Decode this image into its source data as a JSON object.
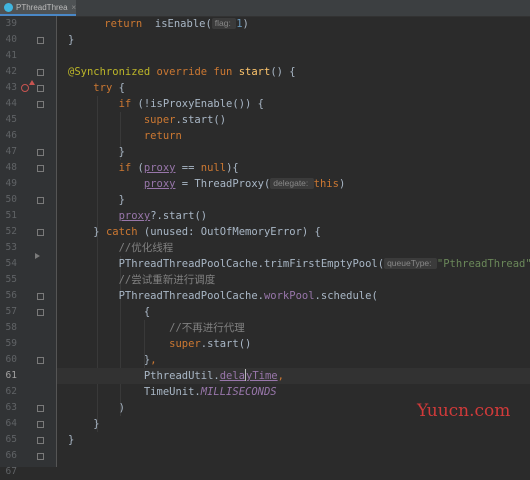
{
  "tab": {
    "label": "PThreadThread.kt",
    "close": "×"
  },
  "current_line": "61",
  "lines": [
    {
      "n": "39",
      "parts": [
        {
          "c": "",
          "t": "    "
        },
        {
          "c": "kw",
          "t": "return "
        },
        {
          "c": "",
          "t": " isEnable("
        },
        {
          "c": "hint",
          "t": "flag: "
        },
        {
          "c": "num",
          "t": "1"
        },
        {
          "c": "",
          "t": ")"
        }
      ]
    },
    {
      "n": "40",
      "parts": [
        {
          "c": "",
          "t": "}"
        }
      ]
    },
    {
      "n": "41",
      "parts": []
    },
    {
      "n": "42",
      "parts": [
        {
          "c": "ann",
          "t": "@Synchronized "
        },
        {
          "c": "kw",
          "t": "override fun "
        },
        {
          "c": "fn",
          "t": "start"
        },
        {
          "c": "",
          "t": "() {"
        }
      ]
    },
    {
      "n": "43",
      "parts": [
        {
          "c": "",
          "t": "    "
        },
        {
          "c": "kw",
          "t": "try "
        },
        {
          "c": "",
          "t": "{"
        }
      ]
    },
    {
      "n": "44",
      "parts": [
        {
          "c": "",
          "t": "        "
        },
        {
          "c": "kw",
          "t": "if "
        },
        {
          "c": "",
          "t": "(!isProxyEnable()) {"
        }
      ]
    },
    {
      "n": "45",
      "parts": [
        {
          "c": "",
          "t": "            "
        },
        {
          "c": "kw",
          "t": "super"
        },
        {
          "c": "",
          "t": ".start()"
        }
      ]
    },
    {
      "n": "46",
      "parts": [
        {
          "c": "",
          "t": "            "
        },
        {
          "c": "kw",
          "t": "return"
        }
      ]
    },
    {
      "n": "47",
      "parts": [
        {
          "c": "",
          "t": "        }"
        }
      ]
    },
    {
      "n": "48",
      "parts": [
        {
          "c": "",
          "t": "        "
        },
        {
          "c": "kw",
          "t": "if "
        },
        {
          "c": "",
          "t": "("
        },
        {
          "c": "prop-u",
          "t": "proxy"
        },
        {
          "c": "",
          "t": " == "
        },
        {
          "c": "kw",
          "t": "null"
        },
        {
          "c": "",
          "t": "){"
        }
      ]
    },
    {
      "n": "49",
      "parts": [
        {
          "c": "",
          "t": "            "
        },
        {
          "c": "prop-u",
          "t": "proxy"
        },
        {
          "c": "",
          "t": " = ThreadProxy("
        },
        {
          "c": "hint",
          "t": "delegate: "
        },
        {
          "c": "kw",
          "t": "this"
        },
        {
          "c": "",
          "t": ")"
        }
      ]
    },
    {
      "n": "50",
      "parts": [
        {
          "c": "",
          "t": "        }"
        }
      ]
    },
    {
      "n": "51",
      "parts": [
        {
          "c": "",
          "t": "        "
        },
        {
          "c": "prop-u",
          "t": "proxy"
        },
        {
          "c": "",
          "t": "?.start()"
        }
      ]
    },
    {
      "n": "52",
      "parts": [
        {
          "c": "",
          "t": "    } "
        },
        {
          "c": "kw",
          "t": "catch "
        },
        {
          "c": "",
          "t": "(unused: OutOfMemoryError) {"
        }
      ]
    },
    {
      "n": "53",
      "parts": [
        {
          "c": "",
          "t": "        "
        },
        {
          "c": "cm",
          "t": "//优化线程"
        }
      ]
    },
    {
      "n": "54",
      "parts": [
        {
          "c": "",
          "t": "        PThreadThreadPoolCache.trimFirstEmptyPool("
        },
        {
          "c": "hint",
          "t": "queueType: "
        },
        {
          "c": "str",
          "t": "\"PthreadThread\""
        },
        {
          "c": "",
          "t": ")"
        }
      ]
    },
    {
      "n": "55",
      "parts": [
        {
          "c": "",
          "t": "        "
        },
        {
          "c": "cm",
          "t": "//尝试重新进行调度"
        }
      ]
    },
    {
      "n": "56",
      "parts": [
        {
          "c": "",
          "t": "        PThreadThreadPoolCache."
        },
        {
          "c": "prop",
          "t": "workPool"
        },
        {
          "c": "",
          "t": ".schedule("
        }
      ]
    },
    {
      "n": "57",
      "parts": [
        {
          "c": "",
          "t": "            {"
        }
      ]
    },
    {
      "n": "58",
      "parts": [
        {
          "c": "",
          "t": "                "
        },
        {
          "c": "cm",
          "t": "//不再进行代理"
        }
      ]
    },
    {
      "n": "59",
      "parts": [
        {
          "c": "",
          "t": "                "
        },
        {
          "c": "kw",
          "t": "super"
        },
        {
          "c": "",
          "t": ".start()"
        }
      ]
    },
    {
      "n": "60",
      "parts": [
        {
          "c": "",
          "t": "            }"
        },
        {
          "c": "kw",
          "t": ","
        }
      ]
    },
    {
      "n": "61",
      "parts": [
        {
          "c": "",
          "t": "            PthreadUtil."
        },
        {
          "c": "prop-u",
          "t": "dela"
        },
        {
          "c": "caret",
          "t": ""
        },
        {
          "c": "prop-u",
          "t": "yTime"
        },
        {
          "c": "kw",
          "t": ","
        }
      ]
    },
    {
      "n": "62",
      "parts": [
        {
          "c": "",
          "t": "            TimeUnit."
        },
        {
          "c": "static",
          "t": "MILLISECONDS"
        }
      ]
    },
    {
      "n": "63",
      "parts": [
        {
          "c": "",
          "t": "        )"
        }
      ]
    },
    {
      "n": "64",
      "parts": [
        {
          "c": "",
          "t": "    }"
        }
      ]
    },
    {
      "n": "65",
      "parts": [
        {
          "c": "",
          "t": "}"
        }
      ]
    },
    {
      "n": "66",
      "parts": []
    },
    {
      "n": "67",
      "parts": []
    }
  ],
  "line_39_prefix": "",
  "folds": [
    "40",
    "42",
    "43",
    "44",
    "47",
    "48",
    "50",
    "52",
    "56",
    "57",
    "60",
    "63",
    "64",
    "65",
    "66"
  ],
  "watermark": "Yuucn.com",
  "colors": {
    "keyword": "#cc7832",
    "annotation": "#bbb529",
    "function": "#ffc66d",
    "property": "#9876aa",
    "comment": "#808080",
    "string": "#6a8759",
    "number": "#6897bb",
    "background": "#2b2b2b"
  }
}
